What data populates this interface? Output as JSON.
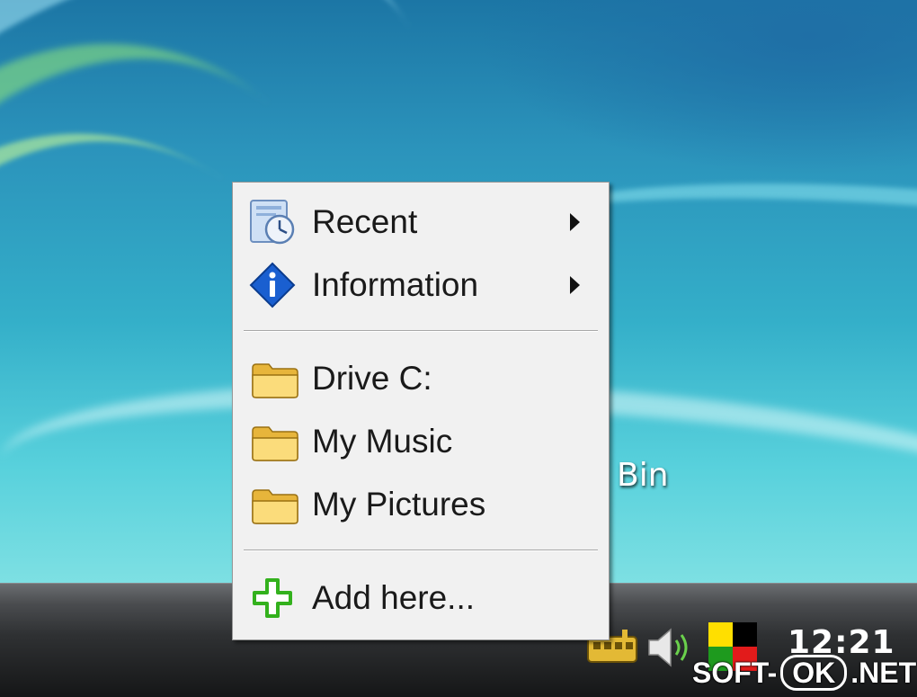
{
  "menu": {
    "items": [
      {
        "label": "Recent",
        "icon": "clock-icon",
        "submenu": true
      },
      {
        "label": "Information",
        "icon": "info-icon",
        "submenu": true
      },
      {
        "label": "Drive C:",
        "icon": "folder-icon",
        "submenu": false
      },
      {
        "label": "My Music",
        "icon": "folder-icon",
        "submenu": false
      },
      {
        "label": "My Pictures",
        "icon": "folder-icon",
        "submenu": false
      },
      {
        "label": "Add here...",
        "icon": "plus-icon",
        "submenu": false
      }
    ]
  },
  "desktop": {
    "partial_icon_label": "Bin"
  },
  "taskbar": {
    "clock": "12:21",
    "tray_icons": [
      "network-icon",
      "volume-icon",
      "colored-flag-icon"
    ]
  },
  "watermark": {
    "prefix": "SOFT-",
    "boxed": "OK",
    "suffix": ".NET"
  },
  "colors": {
    "menu_bg": "#f1f1f1",
    "folder": "#f2c94c",
    "info_blue": "#1a5fd0",
    "plus_green": "#33b11d"
  }
}
